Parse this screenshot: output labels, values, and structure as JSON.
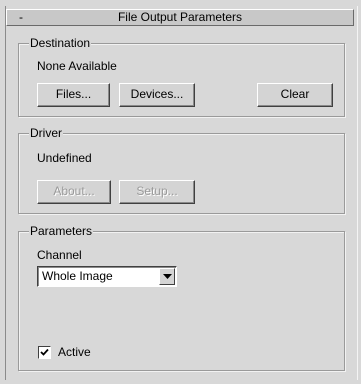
{
  "rollout": {
    "title": "File Output Parameters",
    "collapse_symbol": "-"
  },
  "destination": {
    "label": "Destination",
    "value": "None Available",
    "files_button": "Files...",
    "devices_button": "Devices...",
    "clear_button": "Clear"
  },
  "driver": {
    "label": "Driver",
    "value": "Undefined",
    "about_button": "About...",
    "setup_button": "Setup..."
  },
  "parameters": {
    "label": "Parameters",
    "channel_label": "Channel",
    "channel_selected": "Whole Image",
    "active_label": "Active",
    "active_checked": true
  },
  "icons": {
    "dropdown": "chevron-down-icon",
    "check": "check-icon"
  }
}
